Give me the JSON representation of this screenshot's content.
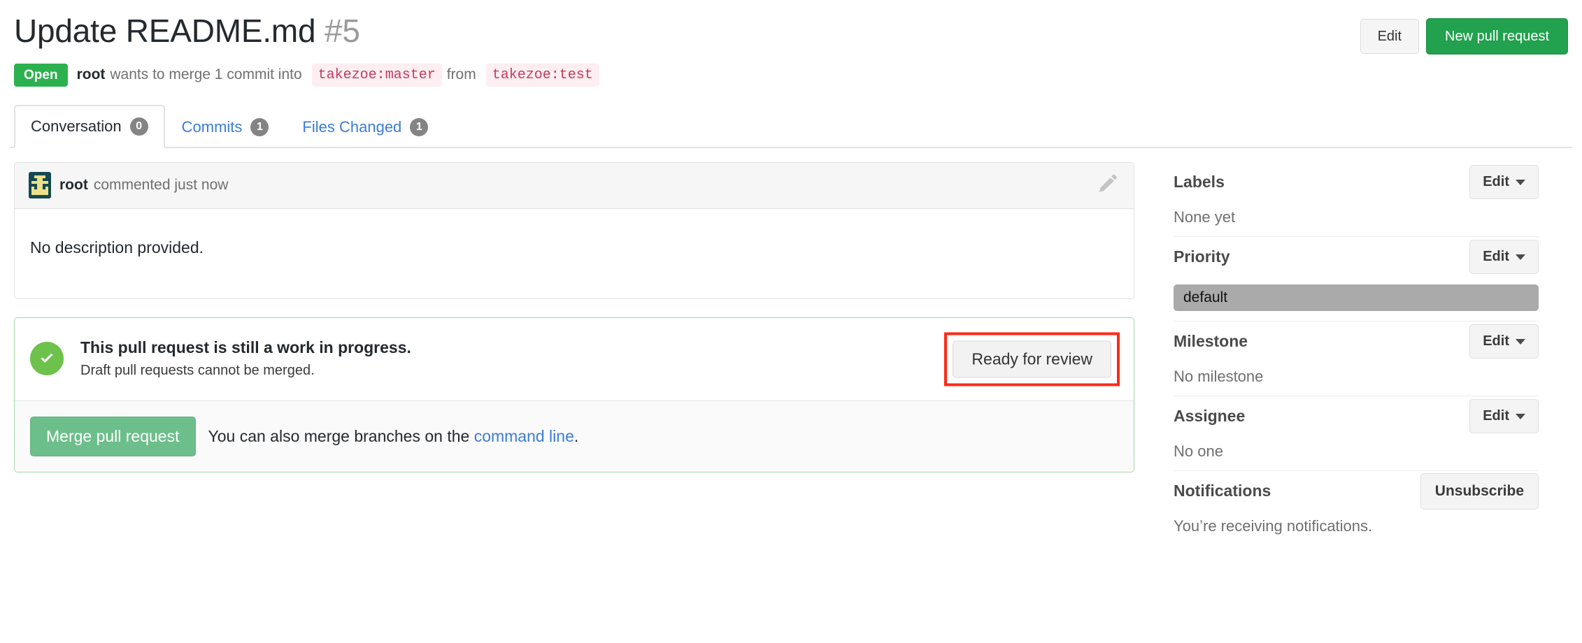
{
  "header": {
    "title": "Update README.md",
    "number": "#5",
    "edit_label": "Edit",
    "new_pr_label": "New pull request"
  },
  "meta": {
    "state": "Open",
    "author": "root",
    "text_before": "wants to merge 1 commit into",
    "base_branch": "takezoe:master",
    "text_from": "from",
    "head_branch": "takezoe:test"
  },
  "tabs": [
    {
      "label": "Conversation",
      "count": "0",
      "active": true
    },
    {
      "label": "Commits",
      "count": "1",
      "active": false
    },
    {
      "label": "Files Changed",
      "count": "1",
      "active": false
    }
  ],
  "comment": {
    "author": "root",
    "when": "commented just now",
    "body": "No description provided.",
    "edit_icon": "pencil-icon",
    "avatar_icon": "identicon-avatar"
  },
  "merge": {
    "status_icon": "check-circle-icon",
    "title": "This pull request is still a work in progress.",
    "subtitle": "Draft pull requests cannot be merged.",
    "ready_label": "Ready for review",
    "merge_label": "Merge pull request",
    "hint_before": "You can also merge branches on the",
    "hint_link": "command line",
    "hint_after": "."
  },
  "sidebar": {
    "labels": {
      "title": "Labels",
      "edit": "Edit",
      "value": "None yet"
    },
    "priority": {
      "title": "Priority",
      "edit": "Edit",
      "value": "default"
    },
    "milestone": {
      "title": "Milestone",
      "edit": "Edit",
      "value": "No milestone"
    },
    "assignee": {
      "title": "Assignee",
      "edit": "Edit",
      "value": "No one"
    },
    "notifications": {
      "title": "Notifications",
      "button": "Unsubscribe",
      "value": "You’re receiving notifications."
    }
  },
  "colors": {
    "open_green": "#2cb14e",
    "primary_green": "#22a14f",
    "link_blue": "#3b7dd8",
    "branch_red": "#c43b5c",
    "highlight_red": "#fc2a19",
    "check_green": "#6cc24a",
    "merge_green": "#6cbe8b",
    "priority_gray": "#aaaaaa"
  }
}
